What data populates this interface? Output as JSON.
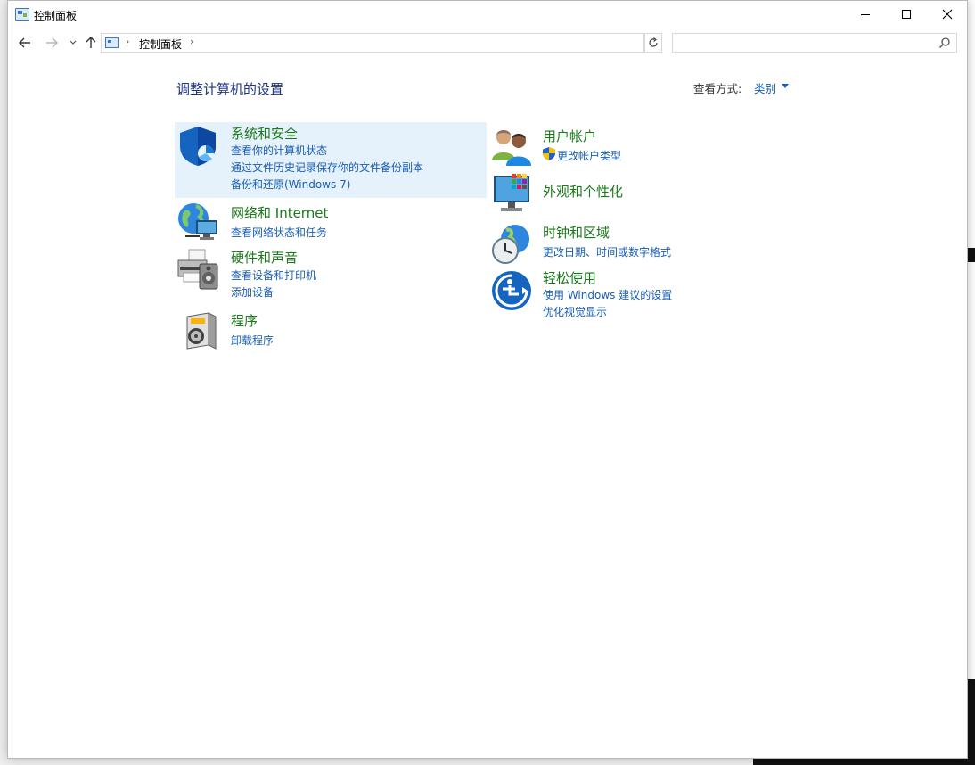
{
  "window": {
    "title": "控制面板"
  },
  "address": {
    "path": [
      "控制面板"
    ],
    "search_placeholder": ""
  },
  "main": {
    "heading": "调整计算机的设置",
    "view_by_label": "查看方式:",
    "view_by_value": "类别"
  },
  "categories": {
    "system_security": {
      "title": "系统和安全",
      "links": [
        "查看你的计算机状态",
        "通过文件历史记录保存你的文件备份副本",
        "备份和还原(Windows 7)"
      ],
      "icon": "shield-icon"
    },
    "network": {
      "title": "网络和 Internet",
      "links": [
        "查看网络状态和任务"
      ],
      "icon": "network-globe-icon"
    },
    "hardware": {
      "title": "硬件和声音",
      "links": [
        "查看设备和打印机",
        "添加设备"
      ],
      "icon": "printer-icon"
    },
    "programs": {
      "title": "程序",
      "links": [
        "卸载程序"
      ],
      "icon": "programs-icon"
    },
    "user_accounts": {
      "title": "用户帐户",
      "links": [
        "更改帐户类型"
      ],
      "icon": "users-icon"
    },
    "appearance": {
      "title": "外观和个性化",
      "links": [],
      "icon": "monitor-color-icon"
    },
    "clock": {
      "title": "时钟和区域",
      "links": [
        "更改日期、时间或数字格式"
      ],
      "icon": "clock-globe-icon"
    },
    "ease": {
      "title": "轻松使用",
      "links": [
        "使用 Windows 建议的设置",
        "优化视觉显示"
      ],
      "icon": "ease-of-access-icon"
    }
  },
  "colors": {
    "category_title": "#1a7a1a",
    "link": "#1a5fb4",
    "heading": "#1e3287",
    "highlight": "#e5f1fb"
  }
}
